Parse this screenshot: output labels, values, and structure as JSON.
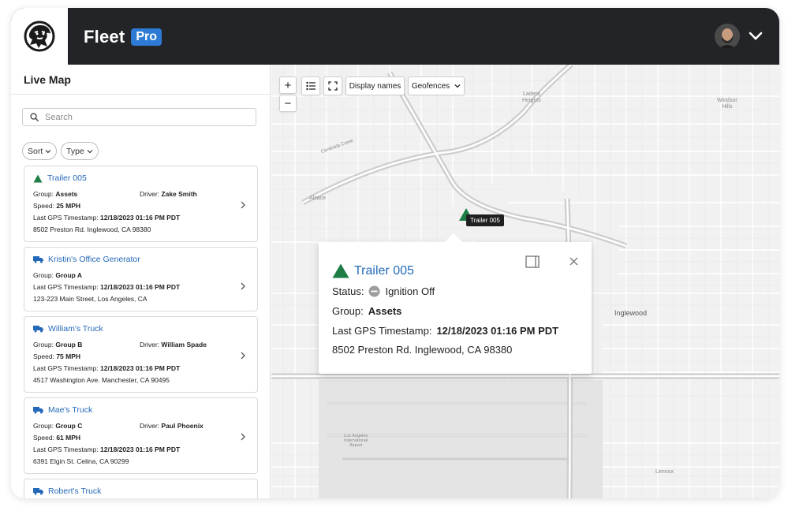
{
  "app": {
    "name": "Fleet",
    "badge": "Pro"
  },
  "sidebar": {
    "title": "Live Map",
    "search_placeholder": "Search",
    "filters": [
      "Sort",
      "Type"
    ]
  },
  "cards": [
    {
      "name": "Trailer 005",
      "icon": "trailer-icon",
      "group": "Assets",
      "driver": "Zake Smith",
      "speed": "25 MPH",
      "timestamp": "12/18/2023 01:16 PM PDT",
      "address": "8502 Preston Rd. Inglewood, CA 98380"
    },
    {
      "name": "Kristin's Office Generator",
      "icon": "truck-icon",
      "group": "Group A",
      "timestamp": "12/18/2023 01:16 PM PDT",
      "address": "123-223 Main Street, Los Angeles, CA"
    },
    {
      "name": "William's Truck",
      "icon": "truck-icon",
      "group": "Group B",
      "driver": "William Spade",
      "speed": "75 MPH",
      "timestamp": "12/18/2023 01:16 PM PDT",
      "address": "4517 Washington Ave. Manchester, CA 90495"
    },
    {
      "name": "Mae's Truck",
      "icon": "truck-icon",
      "group": "Group C",
      "driver": "Paul Phoenix",
      "speed": "61 MPH",
      "timestamp": "12/18/2023 01:16 PM PDT",
      "address": "6391 Elgin St. Celina, CA 90299"
    },
    {
      "name": "Robert's Truck",
      "icon": "truck-icon"
    }
  ],
  "labels": {
    "group": "Group:",
    "driver": "Driver:",
    "speed": "Speed:",
    "timestamp": "Last GPS Timestamp:",
    "status": "Status:"
  },
  "map": {
    "zoom_in": "+",
    "zoom_out": "−",
    "display_names": "Display names",
    "geofences": "Geofences",
    "places": [
      {
        "name": "Ladera\nHeights"
      },
      {
        "name": "Windsor\nHills"
      },
      {
        "name": "Alsace"
      },
      {
        "name": "Inglewood"
      },
      {
        "name": "Lennox"
      },
      {
        "name": "Los Angeles\nInternational\nAirport"
      },
      {
        "name": "Centinela Creek"
      }
    ],
    "marker_label": "Trailer 005"
  },
  "popup": {
    "title": "Trailer 005",
    "status": "Ignition Off",
    "group": "Assets",
    "timestamp": "12/18/2023 01:16 PM PDT",
    "address": "8502 Preston Rd. Inglewood, CA 98380"
  },
  "colors": {
    "header": "#232427",
    "accent": "#2e7bd6",
    "link": "#2469b8",
    "trailer": "#1e7d45"
  }
}
